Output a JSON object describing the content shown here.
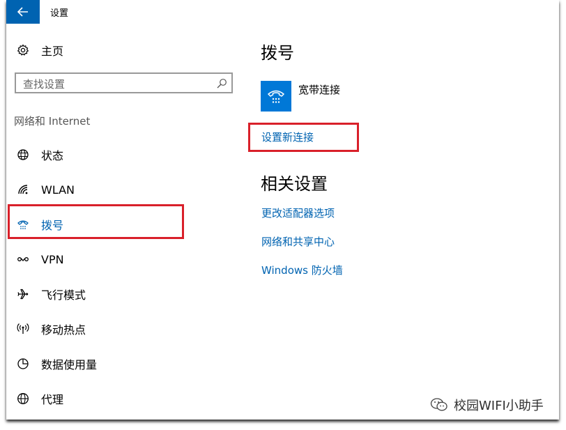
{
  "window": {
    "title": "设置"
  },
  "sidebar": {
    "home_label": "主页",
    "search_placeholder": "查找设置",
    "section_label": "网络和 Internet",
    "items": [
      {
        "label": "状态",
        "icon": "status-globe-icon"
      },
      {
        "label": "WLAN",
        "icon": "wifi-icon"
      },
      {
        "label": "拨号",
        "icon": "dialup-icon",
        "selected": true
      },
      {
        "label": "VPN",
        "icon": "vpn-icon"
      },
      {
        "label": "飞行模式",
        "icon": "airplane-icon"
      },
      {
        "label": "移动热点",
        "icon": "hotspot-icon"
      },
      {
        "label": "数据使用量",
        "icon": "data-usage-icon"
      },
      {
        "label": "代理",
        "icon": "proxy-globe-icon"
      }
    ]
  },
  "main": {
    "title": "拨号",
    "connection": {
      "name": "宽带连接"
    },
    "setup_link": "设置新连接",
    "related_title": "相关设置",
    "related_links": [
      "更改适配器选项",
      "网络和共享中心",
      "Windows 防火墙"
    ]
  },
  "watermark": {
    "text": "校园WIFI小助手"
  },
  "colors": {
    "accent": "#0063b1",
    "tile": "#0078d7",
    "highlight": "#d9202a"
  }
}
